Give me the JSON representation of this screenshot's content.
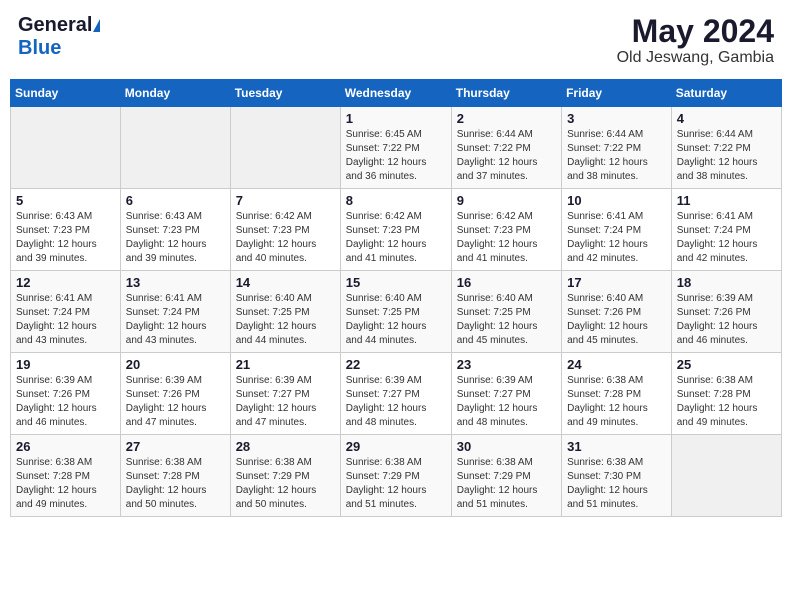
{
  "header": {
    "logo_general": "General",
    "logo_blue": "Blue",
    "month_title": "May 2024",
    "location": "Old Jeswang, Gambia"
  },
  "days_of_week": [
    "Sunday",
    "Monday",
    "Tuesday",
    "Wednesday",
    "Thursday",
    "Friday",
    "Saturday"
  ],
  "weeks": [
    [
      {
        "day": "",
        "sunrise": "",
        "sunset": "",
        "daylight": "",
        "empty": true
      },
      {
        "day": "",
        "sunrise": "",
        "sunset": "",
        "daylight": "",
        "empty": true
      },
      {
        "day": "",
        "sunrise": "",
        "sunset": "",
        "daylight": "",
        "empty": true
      },
      {
        "day": "1",
        "sunrise": "Sunrise: 6:45 AM",
        "sunset": "Sunset: 7:22 PM",
        "daylight": "Daylight: 12 hours and 36 minutes."
      },
      {
        "day": "2",
        "sunrise": "Sunrise: 6:44 AM",
        "sunset": "Sunset: 7:22 PM",
        "daylight": "Daylight: 12 hours and 37 minutes."
      },
      {
        "day": "3",
        "sunrise": "Sunrise: 6:44 AM",
        "sunset": "Sunset: 7:22 PM",
        "daylight": "Daylight: 12 hours and 38 minutes."
      },
      {
        "day": "4",
        "sunrise": "Sunrise: 6:44 AM",
        "sunset": "Sunset: 7:22 PM",
        "daylight": "Daylight: 12 hours and 38 minutes."
      }
    ],
    [
      {
        "day": "5",
        "sunrise": "Sunrise: 6:43 AM",
        "sunset": "Sunset: 7:23 PM",
        "daylight": "Daylight: 12 hours and 39 minutes."
      },
      {
        "day": "6",
        "sunrise": "Sunrise: 6:43 AM",
        "sunset": "Sunset: 7:23 PM",
        "daylight": "Daylight: 12 hours and 39 minutes."
      },
      {
        "day": "7",
        "sunrise": "Sunrise: 6:42 AM",
        "sunset": "Sunset: 7:23 PM",
        "daylight": "Daylight: 12 hours and 40 minutes."
      },
      {
        "day": "8",
        "sunrise": "Sunrise: 6:42 AM",
        "sunset": "Sunset: 7:23 PM",
        "daylight": "Daylight: 12 hours and 41 minutes."
      },
      {
        "day": "9",
        "sunrise": "Sunrise: 6:42 AM",
        "sunset": "Sunset: 7:23 PM",
        "daylight": "Daylight: 12 hours and 41 minutes."
      },
      {
        "day": "10",
        "sunrise": "Sunrise: 6:41 AM",
        "sunset": "Sunset: 7:24 PM",
        "daylight": "Daylight: 12 hours and 42 minutes."
      },
      {
        "day": "11",
        "sunrise": "Sunrise: 6:41 AM",
        "sunset": "Sunset: 7:24 PM",
        "daylight": "Daylight: 12 hours and 42 minutes."
      }
    ],
    [
      {
        "day": "12",
        "sunrise": "Sunrise: 6:41 AM",
        "sunset": "Sunset: 7:24 PM",
        "daylight": "Daylight: 12 hours and 43 minutes."
      },
      {
        "day": "13",
        "sunrise": "Sunrise: 6:41 AM",
        "sunset": "Sunset: 7:24 PM",
        "daylight": "Daylight: 12 hours and 43 minutes."
      },
      {
        "day": "14",
        "sunrise": "Sunrise: 6:40 AM",
        "sunset": "Sunset: 7:25 PM",
        "daylight": "Daylight: 12 hours and 44 minutes."
      },
      {
        "day": "15",
        "sunrise": "Sunrise: 6:40 AM",
        "sunset": "Sunset: 7:25 PM",
        "daylight": "Daylight: 12 hours and 44 minutes."
      },
      {
        "day": "16",
        "sunrise": "Sunrise: 6:40 AM",
        "sunset": "Sunset: 7:25 PM",
        "daylight": "Daylight: 12 hours and 45 minutes."
      },
      {
        "day": "17",
        "sunrise": "Sunrise: 6:40 AM",
        "sunset": "Sunset: 7:26 PM",
        "daylight": "Daylight: 12 hours and 45 minutes."
      },
      {
        "day": "18",
        "sunrise": "Sunrise: 6:39 AM",
        "sunset": "Sunset: 7:26 PM",
        "daylight": "Daylight: 12 hours and 46 minutes."
      }
    ],
    [
      {
        "day": "19",
        "sunrise": "Sunrise: 6:39 AM",
        "sunset": "Sunset: 7:26 PM",
        "daylight": "Daylight: 12 hours and 46 minutes."
      },
      {
        "day": "20",
        "sunrise": "Sunrise: 6:39 AM",
        "sunset": "Sunset: 7:26 PM",
        "daylight": "Daylight: 12 hours and 47 minutes."
      },
      {
        "day": "21",
        "sunrise": "Sunrise: 6:39 AM",
        "sunset": "Sunset: 7:27 PM",
        "daylight": "Daylight: 12 hours and 47 minutes."
      },
      {
        "day": "22",
        "sunrise": "Sunrise: 6:39 AM",
        "sunset": "Sunset: 7:27 PM",
        "daylight": "Daylight: 12 hours and 48 minutes."
      },
      {
        "day": "23",
        "sunrise": "Sunrise: 6:39 AM",
        "sunset": "Sunset: 7:27 PM",
        "daylight": "Daylight: 12 hours and 48 minutes."
      },
      {
        "day": "24",
        "sunrise": "Sunrise: 6:38 AM",
        "sunset": "Sunset: 7:28 PM",
        "daylight": "Daylight: 12 hours and 49 minutes."
      },
      {
        "day": "25",
        "sunrise": "Sunrise: 6:38 AM",
        "sunset": "Sunset: 7:28 PM",
        "daylight": "Daylight: 12 hours and 49 minutes."
      }
    ],
    [
      {
        "day": "26",
        "sunrise": "Sunrise: 6:38 AM",
        "sunset": "Sunset: 7:28 PM",
        "daylight": "Daylight: 12 hours and 49 minutes."
      },
      {
        "day": "27",
        "sunrise": "Sunrise: 6:38 AM",
        "sunset": "Sunset: 7:28 PM",
        "daylight": "Daylight: 12 hours and 50 minutes."
      },
      {
        "day": "28",
        "sunrise": "Sunrise: 6:38 AM",
        "sunset": "Sunset: 7:29 PM",
        "daylight": "Daylight: 12 hours and 50 minutes."
      },
      {
        "day": "29",
        "sunrise": "Sunrise: 6:38 AM",
        "sunset": "Sunset: 7:29 PM",
        "daylight": "Daylight: 12 hours and 51 minutes."
      },
      {
        "day": "30",
        "sunrise": "Sunrise: 6:38 AM",
        "sunset": "Sunset: 7:29 PM",
        "daylight": "Daylight: 12 hours and 51 minutes."
      },
      {
        "day": "31",
        "sunrise": "Sunrise: 6:38 AM",
        "sunset": "Sunset: 7:30 PM",
        "daylight": "Daylight: 12 hours and 51 minutes."
      },
      {
        "day": "",
        "sunrise": "",
        "sunset": "",
        "daylight": "",
        "empty": true
      }
    ]
  ]
}
